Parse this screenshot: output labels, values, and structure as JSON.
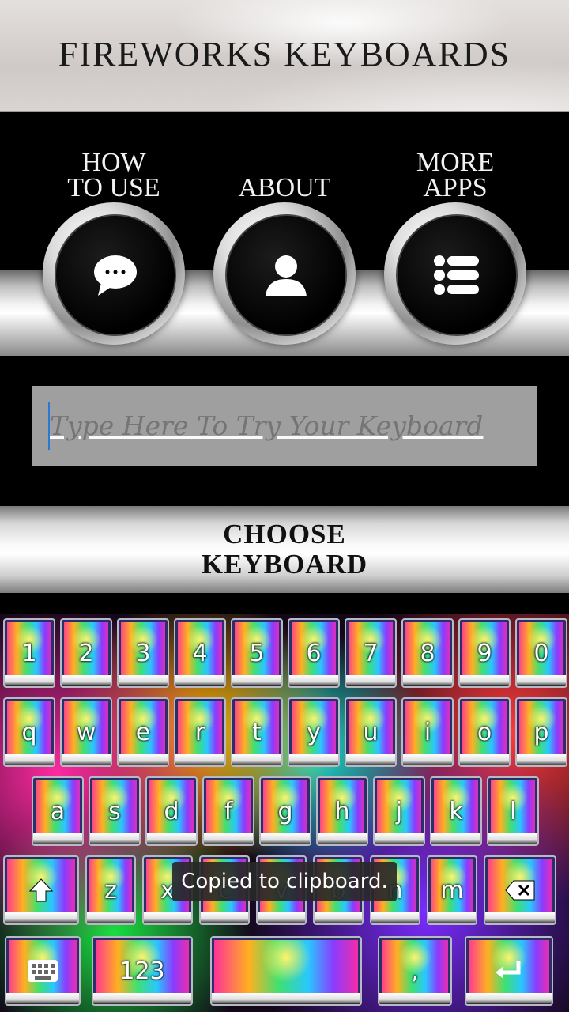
{
  "app_title": "FIREWORKS KEYBOARDS",
  "nav": [
    {
      "label": "HOW\nTO USE",
      "icon": "chat-bubble-icon"
    },
    {
      "label": "ABOUT",
      "icon": "person-icon"
    },
    {
      "label": "MORE\nAPPS",
      "icon": "list-icon"
    }
  ],
  "try_input": {
    "placeholder": "Type Here To Try Your Keyboard"
  },
  "choose_button": {
    "label": "CHOOSE\nKEYBOARD"
  },
  "keyboard": {
    "row1": [
      "1",
      "2",
      "3",
      "4",
      "5",
      "6",
      "7",
      "8",
      "9",
      "0"
    ],
    "row2": [
      "q",
      "w",
      "e",
      "r",
      "t",
      "y",
      "u",
      "i",
      "o",
      "p"
    ],
    "row3": [
      "a",
      "s",
      "d",
      "f",
      "g",
      "h",
      "j",
      "k",
      "l"
    ],
    "row4": [
      "shift",
      "z",
      "x",
      "c",
      "v",
      "b",
      "n",
      "m",
      "backspace"
    ],
    "row5": [
      "emoji",
      "123",
      "space",
      ",",
      "enter"
    ],
    "shift_icon": "shift-icon",
    "backspace_icon": "backspace-icon",
    "emoji_icon": "keyboard-settings-icon",
    "enter_icon": "enter-icon"
  },
  "toast": {
    "message": "Copied to clipboard."
  }
}
